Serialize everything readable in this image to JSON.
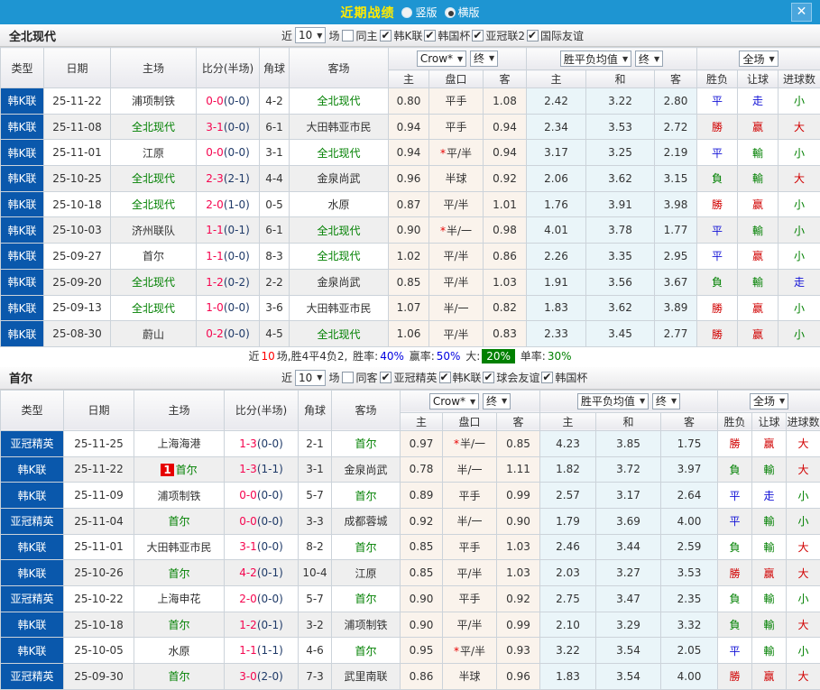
{
  "icons": {
    "close": "✕",
    "dropdown_arrow": "▼"
  },
  "colors": {
    "titlebar_blue": "#1e95d2",
    "league_cell_blue": "#0a58ac",
    "team_green": "#008000",
    "score_red": "#f5054f",
    "half_score_navy": "#1f3a68",
    "win_red": "#d10000",
    "lose_green": "#008000",
    "draw_blue": "#1212d6",
    "odds_bg": "#faf3ec",
    "avg_bg": "#eaf5f9",
    "big_badge_green": "#008000"
  },
  "titlebar": {
    "title": "近期战绩",
    "options": [
      {
        "label": "竖版",
        "selected": false
      },
      {
        "label": "横版",
        "selected": true
      }
    ]
  },
  "table_header": {
    "static_cols": [
      "类型",
      "日期",
      "主场",
      "比分(半场)",
      "角球",
      "客场"
    ],
    "odds_select": "Crow*",
    "final_label": "终",
    "avg_select": "胜平负均值",
    "scope_select": "全场",
    "odds_cols": [
      "主",
      "盘口",
      "客"
    ],
    "avg_cols": [
      "主",
      "和",
      "客"
    ],
    "result_cols": [
      "胜负",
      "让球",
      "进球数"
    ]
  },
  "sections": [
    {
      "team": "全北现代",
      "filter": {
        "near": "近",
        "count": "10",
        "matches": "场",
        "same": {
          "label": "同主",
          "checked": false
        },
        "leagues": [
          {
            "label": "韩K联",
            "checked": true
          },
          {
            "label": "韩国杯",
            "checked": true
          },
          {
            "label": "亚冠联2",
            "checked": true
          },
          {
            "label": "国际友谊",
            "checked": true
          }
        ]
      },
      "rows": [
        {
          "type": "韩K联",
          "date": "25-11-22",
          "home": "浦项制铁",
          "homeGreen": false,
          "badge": "",
          "ft": "0-0",
          "ht": "(0-0)",
          "corner": "4-2",
          "away": "全北现代",
          "awayGreen": true,
          "o1": "0.80",
          "star": false,
          "hc": "平手",
          "o2": "1.08",
          "m1": "2.42",
          "m2": "3.22",
          "m3": "2.80",
          "r": [
            "平",
            "b"
          ],
          "l": [
            "走",
            "b"
          ],
          "g": [
            "小",
            "g"
          ]
        },
        {
          "type": "韩K联",
          "date": "25-11-08",
          "home": "全北现代",
          "homeGreen": true,
          "badge": "",
          "ft": "3-1",
          "ht": "(0-0)",
          "corner": "6-1",
          "away": "大田韩亚市民",
          "awayGreen": false,
          "o1": "0.94",
          "star": false,
          "hc": "平手",
          "o2": "0.94",
          "m1": "2.34",
          "m2": "3.53",
          "m3": "2.72",
          "r": [
            "勝",
            "r"
          ],
          "l": [
            "赢",
            "r"
          ],
          "g": [
            "大",
            "r"
          ]
        },
        {
          "type": "韩K联",
          "date": "25-11-01",
          "home": "江原",
          "homeGreen": false,
          "badge": "",
          "ft": "0-0",
          "ht": "(0-0)",
          "corner": "3-1",
          "away": "全北现代",
          "awayGreen": true,
          "o1": "0.94",
          "star": true,
          "hc": "平/半",
          "o2": "0.94",
          "m1": "3.17",
          "m2": "3.25",
          "m3": "2.19",
          "r": [
            "平",
            "b"
          ],
          "l": [
            "輸",
            "g"
          ],
          "g": [
            "小",
            "g"
          ]
        },
        {
          "type": "韩K联",
          "date": "25-10-25",
          "home": "全北现代",
          "homeGreen": true,
          "badge": "",
          "ft": "2-3",
          "ht": "(2-1)",
          "corner": "4-4",
          "away": "金泉尚武",
          "awayGreen": false,
          "o1": "0.96",
          "star": false,
          "hc": "半球",
          "o2": "0.92",
          "m1": "2.06",
          "m2": "3.62",
          "m3": "3.15",
          "r": [
            "負",
            "g"
          ],
          "l": [
            "輸",
            "g"
          ],
          "g": [
            "大",
            "r"
          ]
        },
        {
          "type": "韩K联",
          "date": "25-10-18",
          "home": "全北现代",
          "homeGreen": true,
          "badge": "",
          "ft": "2-0",
          "ht": "(1-0)",
          "corner": "0-5",
          "away": "水原",
          "awayGreen": false,
          "o1": "0.87",
          "star": false,
          "hc": "平/半",
          "o2": "1.01",
          "m1": "1.76",
          "m2": "3.91",
          "m3": "3.98",
          "r": [
            "勝",
            "r"
          ],
          "l": [
            "赢",
            "r"
          ],
          "g": [
            "小",
            "g"
          ]
        },
        {
          "type": "韩K联",
          "date": "25-10-03",
          "home": "济州联队",
          "homeGreen": false,
          "badge": "",
          "ft": "1-1",
          "ht": "(0-1)",
          "corner": "6-1",
          "away": "全北现代",
          "awayGreen": true,
          "o1": "0.90",
          "star": true,
          "hc": "半/一",
          "o2": "0.98",
          "m1": "4.01",
          "m2": "3.78",
          "m3": "1.77",
          "r": [
            "平",
            "b"
          ],
          "l": [
            "輸",
            "g"
          ],
          "g": [
            "小",
            "g"
          ]
        },
        {
          "type": "韩K联",
          "date": "25-09-27",
          "home": "首尔",
          "homeGreen": false,
          "badge": "",
          "ft": "1-1",
          "ht": "(0-0)",
          "corner": "8-3",
          "away": "全北现代",
          "awayGreen": true,
          "o1": "1.02",
          "star": false,
          "hc": "平/半",
          "o2": "0.86",
          "m1": "2.26",
          "m2": "3.35",
          "m3": "2.95",
          "r": [
            "平",
            "b"
          ],
          "l": [
            "赢",
            "r"
          ],
          "g": [
            "小",
            "g"
          ]
        },
        {
          "type": "韩K联",
          "date": "25-09-20",
          "home": "全北现代",
          "homeGreen": true,
          "badge": "",
          "ft": "1-2",
          "ht": "(0-2)",
          "corner": "2-2",
          "away": "金泉尚武",
          "awayGreen": false,
          "o1": "0.85",
          "star": false,
          "hc": "平/半",
          "o2": "1.03",
          "m1": "1.91",
          "m2": "3.56",
          "m3": "3.67",
          "r": [
            "負",
            "g"
          ],
          "l": [
            "輸",
            "g"
          ],
          "g": [
            "走",
            "b"
          ]
        },
        {
          "type": "韩K联",
          "date": "25-09-13",
          "home": "全北现代",
          "homeGreen": true,
          "badge": "",
          "ft": "1-0",
          "ht": "(0-0)",
          "corner": "3-6",
          "away": "大田韩亚市民",
          "awayGreen": false,
          "o1": "1.07",
          "star": false,
          "hc": "半/一",
          "o2": "0.82",
          "m1": "1.83",
          "m2": "3.62",
          "m3": "3.89",
          "r": [
            "勝",
            "r"
          ],
          "l": [
            "赢",
            "r"
          ],
          "g": [
            "小",
            "g"
          ]
        },
        {
          "type": "韩K联",
          "date": "25-08-30",
          "home": "蔚山",
          "homeGreen": false,
          "badge": "",
          "ft": "0-2",
          "ht": "(0-0)",
          "corner": "4-5",
          "away": "全北现代",
          "awayGreen": true,
          "o1": "1.06",
          "star": false,
          "hc": "平/半",
          "o2": "0.83",
          "m1": "2.33",
          "m2": "3.45",
          "m3": "2.77",
          "r": [
            "勝",
            "r"
          ],
          "l": [
            "赢",
            "r"
          ],
          "g": [
            "小",
            "g"
          ]
        }
      ],
      "summary": {
        "near": "近",
        "count": "10",
        "record": "场,胜4平4负2,",
        "win_label": "胜率:",
        "win": "40%",
        "profit_label": "赢率:",
        "profit": "50%",
        "big_label": "大:",
        "big": "20%",
        "single_label": "单率:",
        "single": "30%"
      }
    },
    {
      "team": "首尔",
      "filter": {
        "near": "近",
        "count": "10",
        "matches": "场",
        "same": {
          "label": "同客",
          "checked": false
        },
        "leagues": [
          {
            "label": "亚冠精英",
            "checked": true
          },
          {
            "label": "韩K联",
            "checked": true
          },
          {
            "label": "球会友谊",
            "checked": true
          },
          {
            "label": "韩国杯",
            "checked": true
          }
        ]
      },
      "rows": [
        {
          "type": "亚冠精英",
          "date": "25-11-25",
          "home": "上海海港",
          "homeGreen": false,
          "badge": "",
          "ft": "1-3",
          "ht": "(0-0)",
          "corner": "2-1",
          "away": "首尔",
          "awayGreen": true,
          "o1": "0.97",
          "star": true,
          "hc": "半/一",
          "o2": "0.85",
          "m1": "4.23",
          "m2": "3.85",
          "m3": "1.75",
          "r": [
            "勝",
            "r"
          ],
          "l": [
            "赢",
            "r"
          ],
          "g": [
            "大",
            "r"
          ]
        },
        {
          "type": "韩K联",
          "date": "25-11-22",
          "home": "首尔",
          "homeGreen": true,
          "badge": "1",
          "ft": "1-3",
          "ht": "(1-1)",
          "corner": "3-1",
          "away": "金泉尚武",
          "awayGreen": false,
          "o1": "0.78",
          "star": false,
          "hc": "半/一",
          "o2": "1.11",
          "m1": "1.82",
          "m2": "3.72",
          "m3": "3.97",
          "r": [
            "負",
            "g"
          ],
          "l": [
            "輸",
            "g"
          ],
          "g": [
            "大",
            "r"
          ]
        },
        {
          "type": "韩K联",
          "date": "25-11-09",
          "home": "浦项制铁",
          "homeGreen": false,
          "badge": "",
          "ft": "0-0",
          "ht": "(0-0)",
          "corner": "5-7",
          "away": "首尔",
          "awayGreen": true,
          "o1": "0.89",
          "star": false,
          "hc": "平手",
          "o2": "0.99",
          "m1": "2.57",
          "m2": "3.17",
          "m3": "2.64",
          "r": [
            "平",
            "b"
          ],
          "l": [
            "走",
            "b"
          ],
          "g": [
            "小",
            "g"
          ]
        },
        {
          "type": "亚冠精英",
          "date": "25-11-04",
          "home": "首尔",
          "homeGreen": true,
          "badge": "",
          "ft": "0-0",
          "ht": "(0-0)",
          "corner": "3-3",
          "away": "成都蓉城",
          "awayGreen": false,
          "o1": "0.92",
          "star": false,
          "hc": "半/一",
          "o2": "0.90",
          "m1": "1.79",
          "m2": "3.69",
          "m3": "4.00",
          "r": [
            "平",
            "b"
          ],
          "l": [
            "輸",
            "g"
          ],
          "g": [
            "小",
            "g"
          ]
        },
        {
          "type": "韩K联",
          "date": "25-11-01",
          "home": "大田韩亚市民",
          "homeGreen": false,
          "badge": "",
          "ft": "3-1",
          "ht": "(0-0)",
          "corner": "8-2",
          "away": "首尔",
          "awayGreen": true,
          "o1": "0.85",
          "star": false,
          "hc": "平手",
          "o2": "1.03",
          "m1": "2.46",
          "m2": "3.44",
          "m3": "2.59",
          "r": [
            "負",
            "g"
          ],
          "l": [
            "輸",
            "g"
          ],
          "g": [
            "大",
            "r"
          ]
        },
        {
          "type": "韩K联",
          "date": "25-10-26",
          "home": "首尔",
          "homeGreen": true,
          "badge": "",
          "ft": "4-2",
          "ht": "(0-1)",
          "corner": "10-4",
          "away": "江原",
          "awayGreen": false,
          "o1": "0.85",
          "star": false,
          "hc": "平/半",
          "o2": "1.03",
          "m1": "2.03",
          "m2": "3.27",
          "m3": "3.53",
          "r": [
            "勝",
            "r"
          ],
          "l": [
            "赢",
            "r"
          ],
          "g": [
            "大",
            "r"
          ]
        },
        {
          "type": "亚冠精英",
          "date": "25-10-22",
          "home": "上海申花",
          "homeGreen": false,
          "badge": "",
          "ft": "2-0",
          "ht": "(0-0)",
          "corner": "5-7",
          "away": "首尔",
          "awayGreen": true,
          "o1": "0.90",
          "star": false,
          "hc": "平手",
          "o2": "0.92",
          "m1": "2.75",
          "m2": "3.47",
          "m3": "2.35",
          "r": [
            "負",
            "g"
          ],
          "l": [
            "輸",
            "g"
          ],
          "g": [
            "小",
            "g"
          ]
        },
        {
          "type": "韩K联",
          "date": "25-10-18",
          "home": "首尔",
          "homeGreen": true,
          "badge": "",
          "ft": "1-2",
          "ht": "(0-1)",
          "corner": "3-2",
          "away": "浦项制铁",
          "awayGreen": false,
          "o1": "0.90",
          "star": false,
          "hc": "平/半",
          "o2": "0.99",
          "m1": "2.10",
          "m2": "3.29",
          "m3": "3.32",
          "r": [
            "負",
            "g"
          ],
          "l": [
            "輸",
            "g"
          ],
          "g": [
            "大",
            "r"
          ]
        },
        {
          "type": "韩K联",
          "date": "25-10-05",
          "home": "水原",
          "homeGreen": false,
          "badge": "",
          "ft": "1-1",
          "ht": "(1-1)",
          "corner": "4-6",
          "away": "首尔",
          "awayGreen": true,
          "o1": "0.95",
          "star": true,
          "hc": "平/半",
          "o2": "0.93",
          "m1": "3.22",
          "m2": "3.54",
          "m3": "2.05",
          "r": [
            "平",
            "b"
          ],
          "l": [
            "輸",
            "g"
          ],
          "g": [
            "小",
            "g"
          ]
        },
        {
          "type": "亚冠精英",
          "date": "25-09-30",
          "home": "首尔",
          "homeGreen": true,
          "badge": "",
          "ft": "3-0",
          "ht": "(2-0)",
          "corner": "7-3",
          "away": "武里南联",
          "awayGreen": false,
          "o1": "0.86",
          "star": false,
          "hc": "半球",
          "o2": "0.96",
          "m1": "1.83",
          "m2": "3.54",
          "m3": "4.00",
          "r": [
            "勝",
            "r"
          ],
          "l": [
            "赢",
            "r"
          ],
          "g": [
            "大",
            "r"
          ]
        }
      ]
    }
  ]
}
